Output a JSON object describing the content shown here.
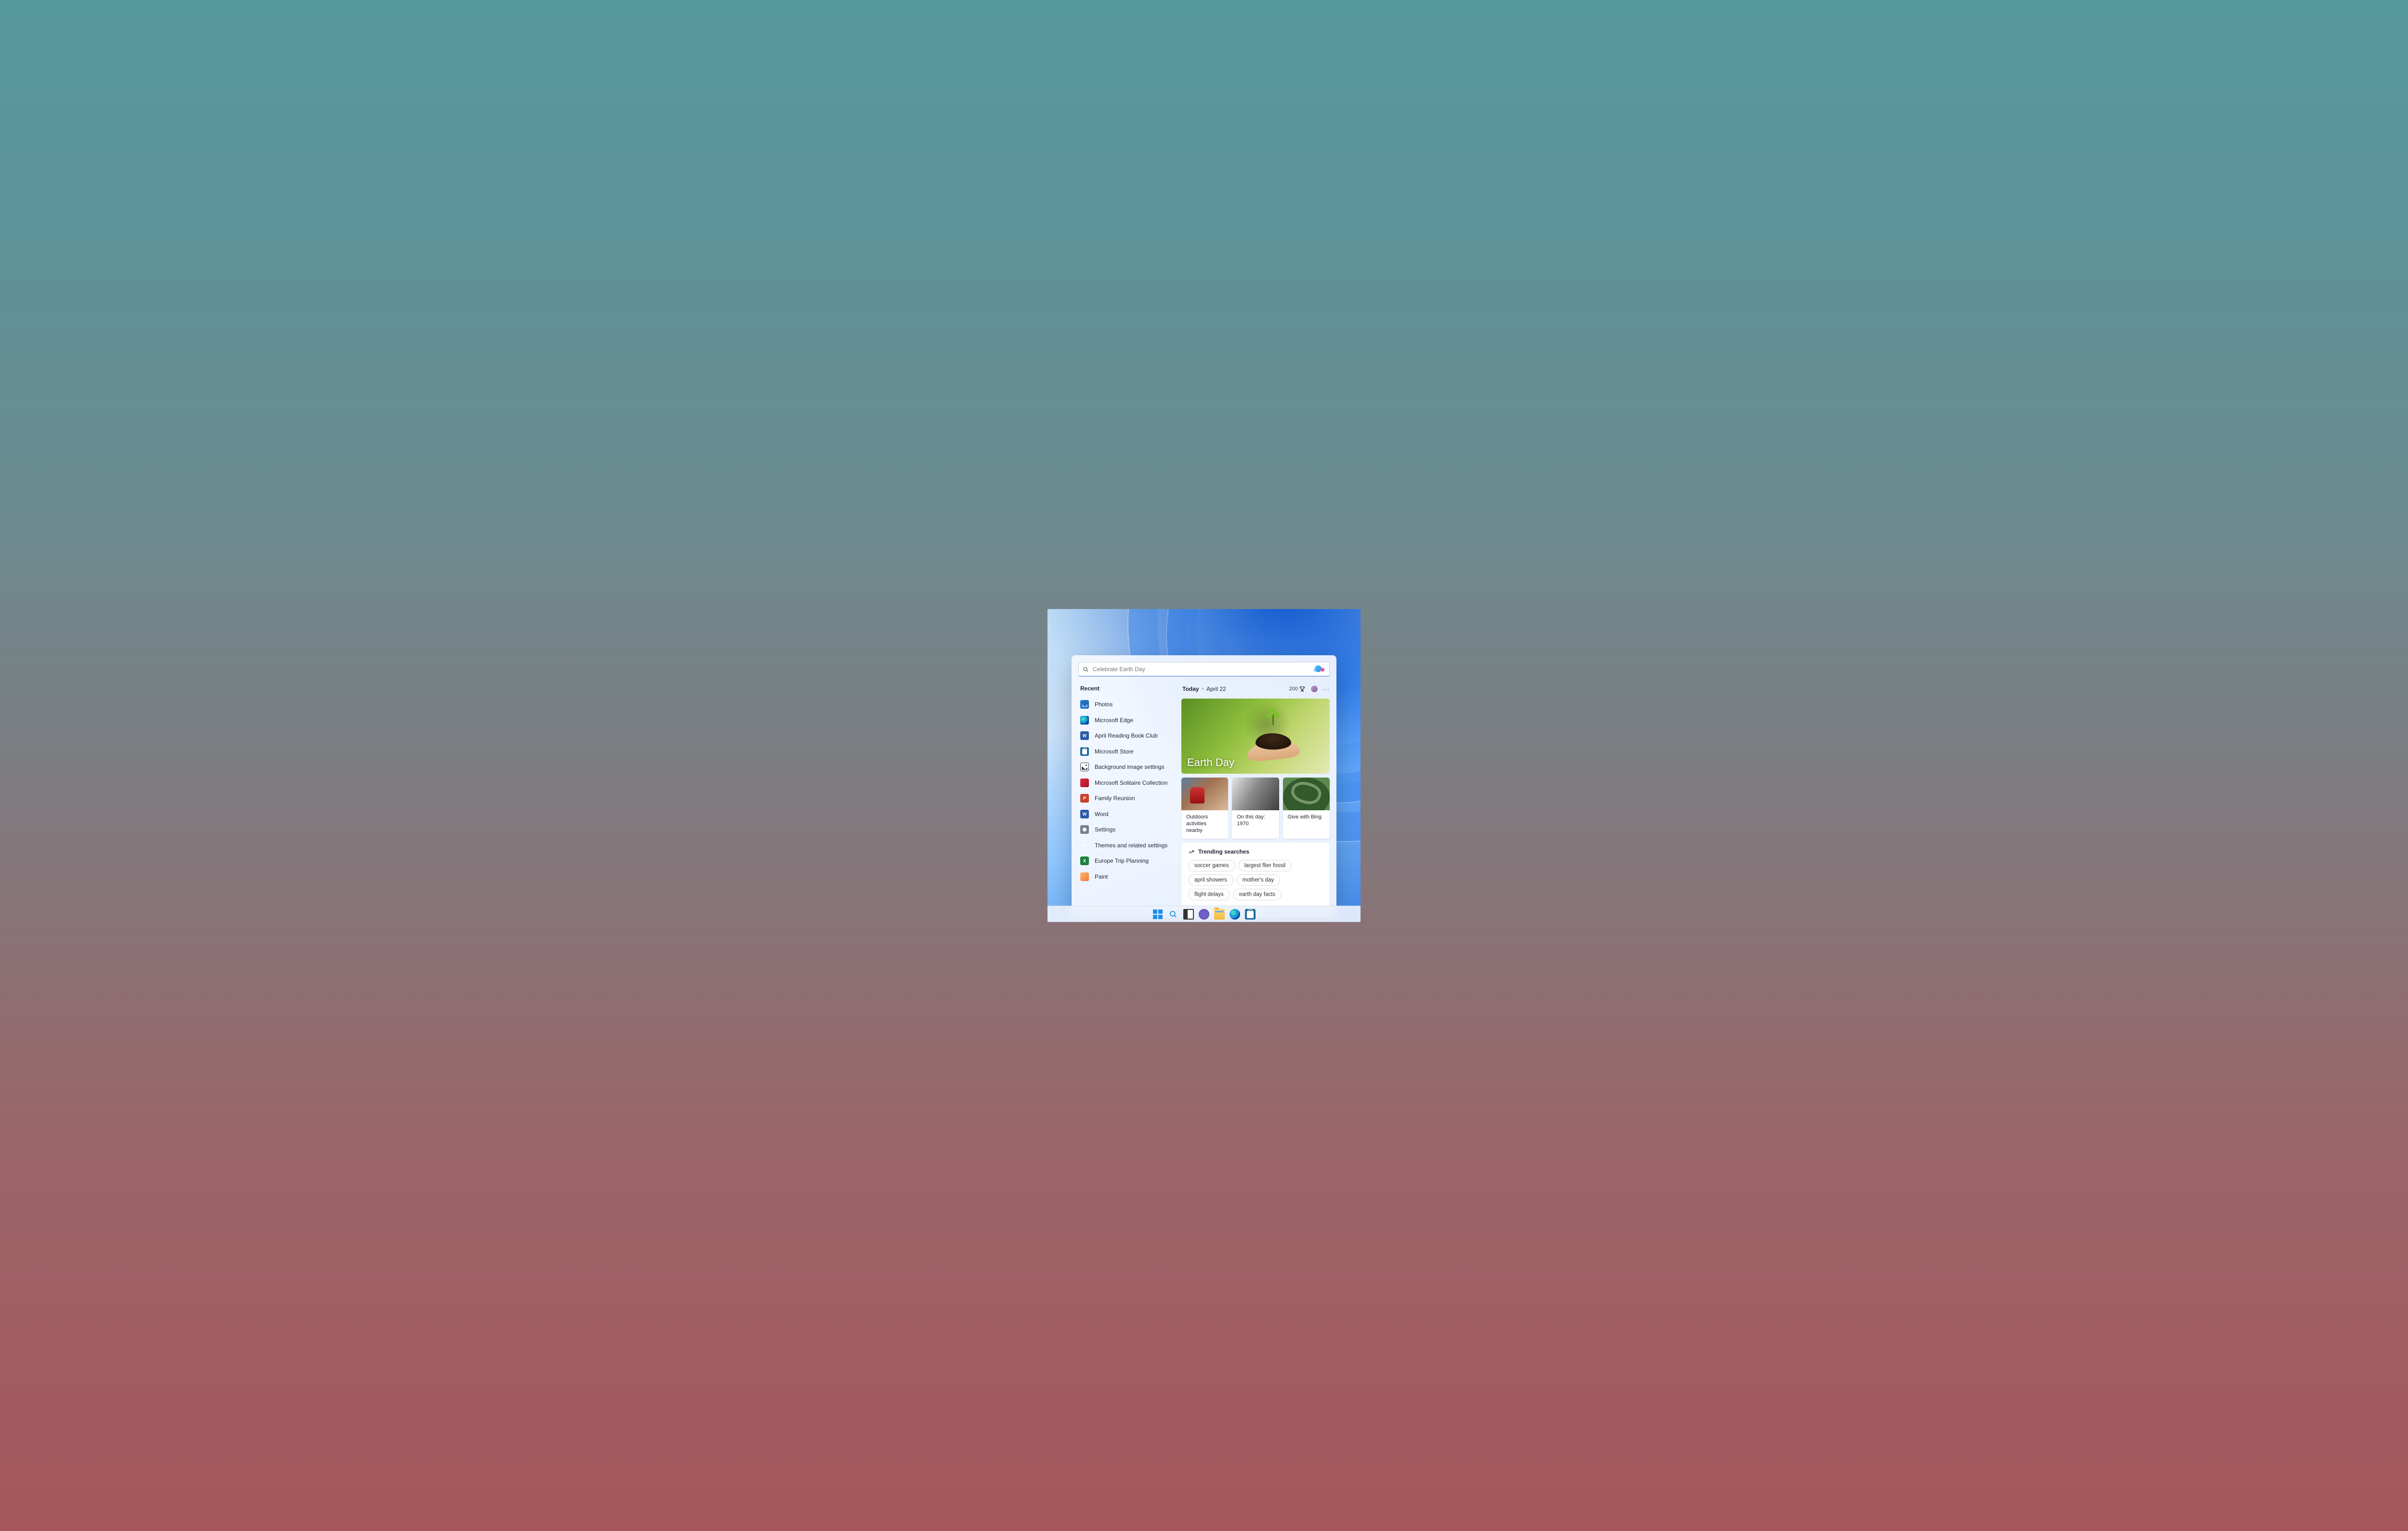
{
  "search": {
    "placeholder": "Celebrate Earth Day"
  },
  "recent_header": "Recent",
  "recent": [
    {
      "label": "Photos",
      "icon": "photos"
    },
    {
      "label": "Microsoft Edge",
      "icon": "edge"
    },
    {
      "label": "April Reading Book Club",
      "icon": "word"
    },
    {
      "label": "Microsoft Store",
      "icon": "store"
    },
    {
      "label": "Background image settings",
      "icon": "image"
    },
    {
      "label": "Microsoft Solitaire Collection",
      "icon": "solitaire"
    },
    {
      "label": "Family Reunion",
      "icon": "ppt"
    },
    {
      "label": "Word",
      "icon": "word"
    },
    {
      "label": "Settings",
      "icon": "gear"
    },
    {
      "label": "Themes and related settings",
      "icon": "pencil"
    },
    {
      "label": "Europe Trip Planning",
      "icon": "excel"
    },
    {
      "label": "Paint",
      "icon": "paint"
    }
  ],
  "today": {
    "label": "Today",
    "date": "April 22",
    "rewards_points": "200"
  },
  "hero": {
    "title": "Earth Day"
  },
  "cards": [
    {
      "caption": "Outdoors activities nearby"
    },
    {
      "caption": "On this day: 1970"
    },
    {
      "caption": "Give with Bing"
    }
  ],
  "trending": {
    "label": "Trending searches",
    "items": [
      "soccer games",
      "largest flier fossil",
      "april showers",
      "mother's day",
      "flight delays",
      "earth day facts"
    ]
  },
  "icon_classes": {
    "photos": "ico-photos",
    "edge": "ico-edge",
    "word": "ico-word",
    "store": "ico-store",
    "image": "ico-img",
    "solitaire": "ico-solitaire",
    "ppt": "ico-ppt",
    "gear": "ico-gear",
    "pencil": "ico-pencil",
    "excel": "ico-excel",
    "paint": "ico-paint"
  },
  "icon_text": {
    "word": "W",
    "ppt": "P",
    "excel": "X",
    "pencil": "✎"
  }
}
